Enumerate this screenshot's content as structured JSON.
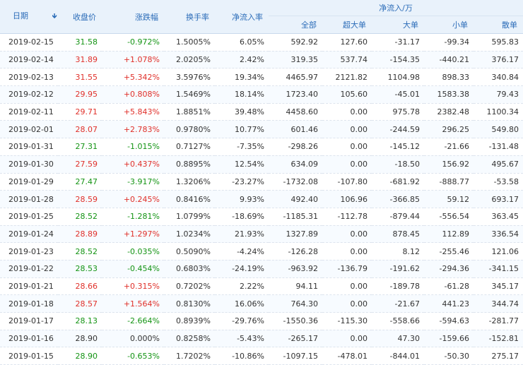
{
  "header": {
    "date": "日期",
    "close": "收盘价",
    "change": "涨跌幅",
    "turnover": "换手率",
    "inflow_rate": "净流入率",
    "net_inflow_group": "净流入/万",
    "total": "全部",
    "extra_large": "超大单",
    "large": "大单",
    "medium": "小单",
    "small": "散单",
    "sort_icon": "arrow-down-icon"
  },
  "colors": {
    "up": "#e0302a",
    "down": "#149414",
    "header_bg": "#e9f2fb",
    "header_text": "#2b6cb8"
  },
  "rows": [
    {
      "date": "2019-02-15",
      "close": "31.58",
      "change": "-0.972%",
      "turnover": "1.5005%",
      "inflow_rate": "6.05%",
      "total": "592.92",
      "xl": "127.60",
      "l": "-31.17",
      "m": "-99.34",
      "s": "595.83",
      "trend": "down"
    },
    {
      "date": "2019-02-14",
      "close": "31.89",
      "change": "+1.078%",
      "turnover": "2.0205%",
      "inflow_rate": "2.42%",
      "total": "319.35",
      "xl": "537.74",
      "l": "-154.35",
      "m": "-440.21",
      "s": "376.17",
      "trend": "up"
    },
    {
      "date": "2019-02-13",
      "close": "31.55",
      "change": "+5.342%",
      "turnover": "3.5976%",
      "inflow_rate": "19.34%",
      "total": "4465.97",
      "xl": "2121.82",
      "l": "1104.98",
      "m": "898.33",
      "s": "340.84",
      "trend": "up"
    },
    {
      "date": "2019-02-12",
      "close": "29.95",
      "change": "+0.808%",
      "turnover": "1.5469%",
      "inflow_rate": "18.14%",
      "total": "1723.40",
      "xl": "105.60",
      "l": "-45.01",
      "m": "1583.38",
      "s": "79.43",
      "trend": "up"
    },
    {
      "date": "2019-02-11",
      "close": "29.71",
      "change": "+5.843%",
      "turnover": "1.8851%",
      "inflow_rate": "39.48%",
      "total": "4458.60",
      "xl": "0.00",
      "l": "975.78",
      "m": "2382.48",
      "s": "1100.34",
      "trend": "up"
    },
    {
      "date": "2019-02-01",
      "close": "28.07",
      "change": "+2.783%",
      "turnover": "0.9780%",
      "inflow_rate": "10.77%",
      "total": "601.46",
      "xl": "0.00",
      "l": "-244.59",
      "m": "296.25",
      "s": "549.80",
      "trend": "up"
    },
    {
      "date": "2019-01-31",
      "close": "27.31",
      "change": "-1.015%",
      "turnover": "0.7127%",
      "inflow_rate": "-7.35%",
      "total": "-298.26",
      "xl": "0.00",
      "l": "-145.12",
      "m": "-21.66",
      "s": "-131.48",
      "trend": "down"
    },
    {
      "date": "2019-01-30",
      "close": "27.59",
      "change": "+0.437%",
      "turnover": "0.8895%",
      "inflow_rate": "12.54%",
      "total": "634.09",
      "xl": "0.00",
      "l": "-18.50",
      "m": "156.92",
      "s": "495.67",
      "trend": "up"
    },
    {
      "date": "2019-01-29",
      "close": "27.47",
      "change": "-3.917%",
      "turnover": "1.3206%",
      "inflow_rate": "-23.27%",
      "total": "-1732.08",
      "xl": "-107.80",
      "l": "-681.92",
      "m": "-888.77",
      "s": "-53.58",
      "trend": "down"
    },
    {
      "date": "2019-01-28",
      "close": "28.59",
      "change": "+0.245%",
      "turnover": "0.8416%",
      "inflow_rate": "9.93%",
      "total": "492.40",
      "xl": "106.96",
      "l": "-366.85",
      "m": "59.12",
      "s": "693.17",
      "trend": "up"
    },
    {
      "date": "2019-01-25",
      "close": "28.52",
      "change": "-1.281%",
      "turnover": "1.0799%",
      "inflow_rate": "-18.69%",
      "total": "-1185.31",
      "xl": "-112.78",
      "l": "-879.44",
      "m": "-556.54",
      "s": "363.45",
      "trend": "down"
    },
    {
      "date": "2019-01-24",
      "close": "28.89",
      "change": "+1.297%",
      "turnover": "1.0234%",
      "inflow_rate": "21.93%",
      "total": "1327.89",
      "xl": "0.00",
      "l": "878.45",
      "m": "112.89",
      "s": "336.54",
      "trend": "up"
    },
    {
      "date": "2019-01-23",
      "close": "28.52",
      "change": "-0.035%",
      "turnover": "0.5090%",
      "inflow_rate": "-4.24%",
      "total": "-126.28",
      "xl": "0.00",
      "l": "8.12",
      "m": "-255.46",
      "s": "121.06",
      "trend": "down"
    },
    {
      "date": "2019-01-22",
      "close": "28.53",
      "change": "-0.454%",
      "turnover": "0.6803%",
      "inflow_rate": "-24.19%",
      "total": "-963.92",
      "xl": "-136.79",
      "l": "-191.62",
      "m": "-294.36",
      "s": "-341.15",
      "trend": "down"
    },
    {
      "date": "2019-01-21",
      "close": "28.66",
      "change": "+0.315%",
      "turnover": "0.7202%",
      "inflow_rate": "2.22%",
      "total": "94.11",
      "xl": "0.00",
      "l": "-189.78",
      "m": "-61.28",
      "s": "345.17",
      "trend": "up"
    },
    {
      "date": "2019-01-18",
      "close": "28.57",
      "change": "+1.564%",
      "turnover": "0.8130%",
      "inflow_rate": "16.06%",
      "total": "764.30",
      "xl": "0.00",
      "l": "-21.67",
      "m": "441.23",
      "s": "344.74",
      "trend": "up"
    },
    {
      "date": "2019-01-17",
      "close": "28.13",
      "change": "-2.664%",
      "turnover": "0.8939%",
      "inflow_rate": "-29.76%",
      "total": "-1550.36",
      "xl": "-115.30",
      "l": "-558.66",
      "m": "-594.63",
      "s": "-281.77",
      "trend": "down"
    },
    {
      "date": "2019-01-16",
      "close": "28.90",
      "change": "0.000%",
      "turnover": "0.8258%",
      "inflow_rate": "-5.43%",
      "total": "-265.17",
      "xl": "0.00",
      "l": "47.30",
      "m": "-159.66",
      "s": "-152.81",
      "trend": "flat"
    },
    {
      "date": "2019-01-15",
      "close": "28.90",
      "change": "-0.653%",
      "turnover": "1.7202%",
      "inflow_rate": "-10.86%",
      "total": "-1097.15",
      "xl": "-478.01",
      "l": "-844.01",
      "m": "-50.30",
      "s": "275.17",
      "trend": "down"
    }
  ]
}
